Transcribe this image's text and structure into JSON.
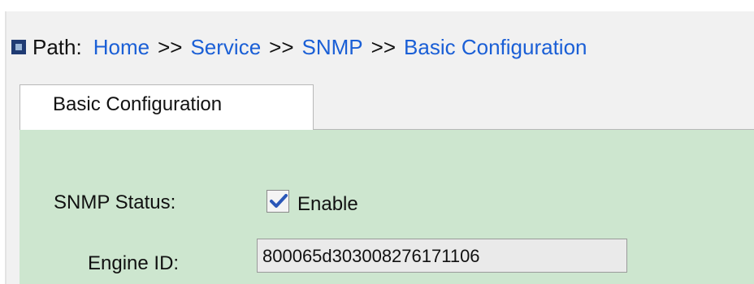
{
  "path": {
    "label": "Path:",
    "crumbs": [
      "Home",
      "Service",
      "SNMP",
      "Basic Configuration"
    ],
    "separator": ">>"
  },
  "tabs": [
    {
      "label": "Basic Configuration",
      "active": true
    }
  ],
  "form": {
    "snmp_status": {
      "label": "SNMP Status:",
      "checkbox_label": "Enable",
      "checked": true
    },
    "engine_id": {
      "label": "Engine ID:",
      "value": "800065d303008276171106"
    }
  },
  "colors": {
    "page_bg": "#f1f1f1",
    "content_bg": "#cde6cf",
    "link": "#1a5fd6",
    "path_icon": "#1f3b73",
    "check": "#2a57b8"
  },
  "icons": {
    "path": "square-icon",
    "checkbox": "checkmark-icon"
  }
}
